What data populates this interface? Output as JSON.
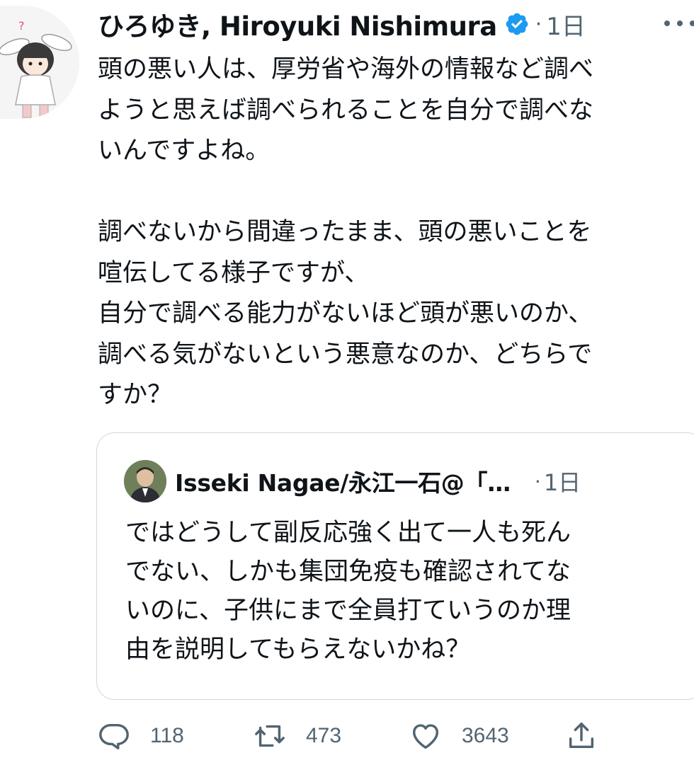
{
  "tweet": {
    "author_name": "ひろゆき, Hiroyuki Nishimura",
    "verified": true,
    "time": "1日",
    "text_lines": [
      "頭の悪い人は、厚労省や海外の情報など調べ",
      "ようと思えば調べられることを自分で調べな",
      "いんですよね。",
      "",
      "調べないから間違ったまま、頭の悪いことを",
      "喧伝してる様子ですが、",
      "自分で調べる能力がないほど頭が悪いのか、",
      "調べる気がないという悪意なのか、どちらで",
      "すか？"
    ]
  },
  "quote": {
    "author_name": "Isseki Nagae/永江一石@「…",
    "time": "1日",
    "text_lines": [
      "ではどうして副反応強く出て一人も死ん",
      "でない、しかも集団免疫も確認されてな",
      "いのに、子供にまで全員打ていうのか理",
      "由を説明してもらえないかね？"
    ]
  },
  "actions": {
    "replies": "118",
    "retweets": "473",
    "likes": "3643"
  },
  "colors": {
    "text": "#0f1419",
    "secondary": "#536471",
    "verified": "#1d9bf0",
    "border": "#cfd9de"
  },
  "icons": {
    "reply": "reply-icon",
    "retweet": "retweet-icon",
    "like": "heart-icon",
    "share": "share-icon",
    "verified": "verified-badge-icon",
    "more": "more-icon"
  }
}
